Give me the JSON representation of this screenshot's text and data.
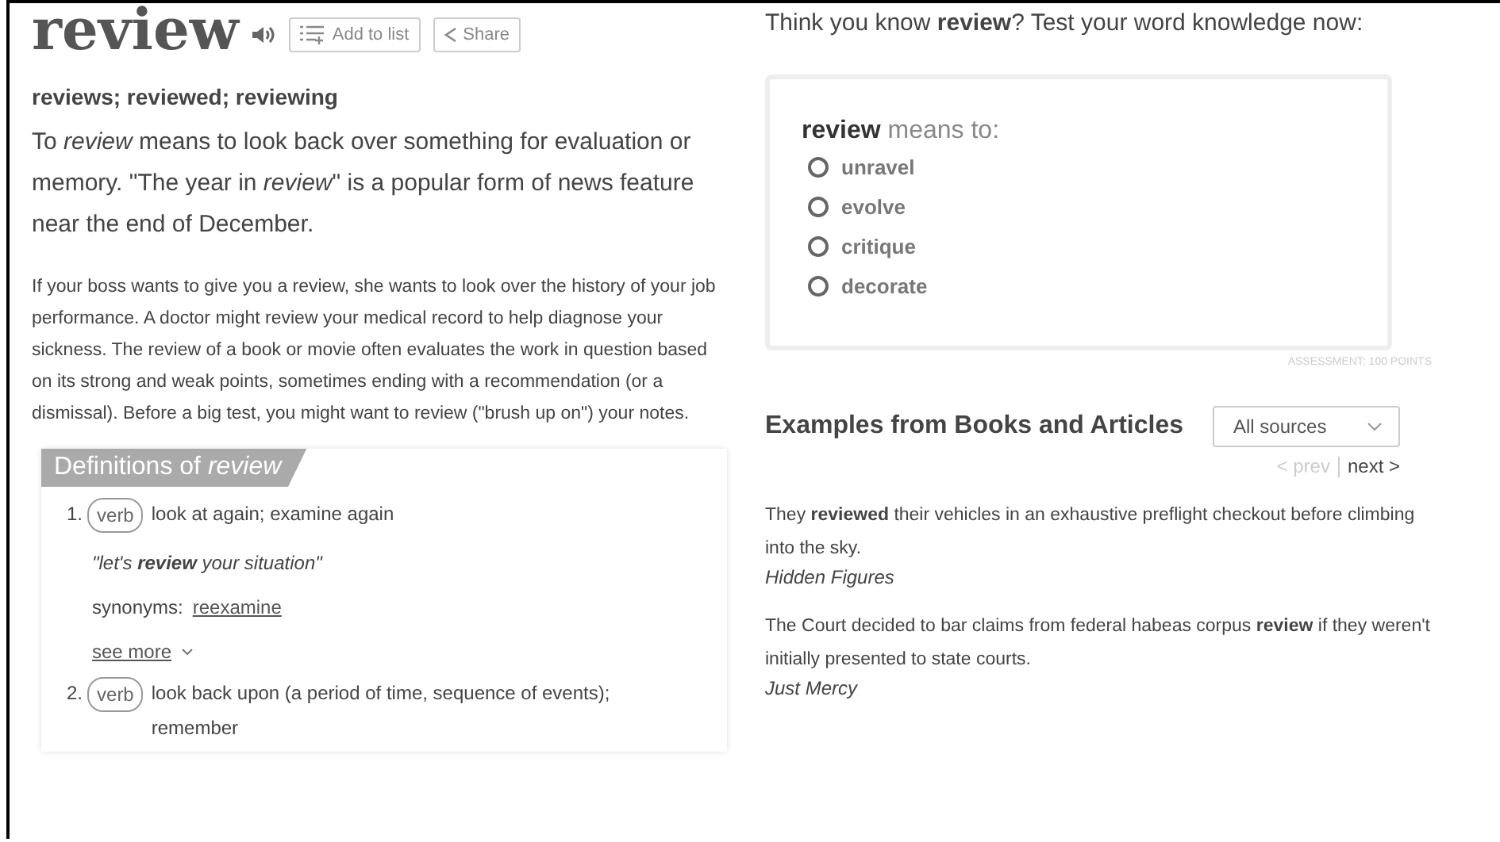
{
  "entry": {
    "word": "review",
    "actions": [
      {
        "label": "Add to list",
        "kind": "list"
      },
      {
        "label": "Share",
        "kind": "share"
      }
    ],
    "forms": "reviews; reviewed; reviewing",
    "short_definition": "To *review* means to look back over something for evaluation or memory. \"The year in *review*\" is a popular form of news feature near the end of December.",
    "long_definition": "If your boss wants to give you a review, she wants to look over the history of your job performance. A doctor might review your medical record to help diagnose your sickness. The review of a book or movie often evaluates the work in question based on its strong and weak points, sometimes ending with a recommendation (or a dismissal). Before a big test, you might want to review (\"brush up on\") your notes."
  },
  "definitions": {
    "title": "Definitions of *review*",
    "senses": [
      {
        "number": "1.",
        "pos": "verb",
        "gloss": "look at again; examine again",
        "example": "\"let's **review** your situation\"",
        "synonyms_label": "synonyms:",
        "synonyms": [
          "reexamine"
        ],
        "see_more": "see more"
      },
      {
        "number": "2.",
        "pos": "verb",
        "gloss": "look back upon (a period of time, sequence of events); remember"
      }
    ]
  },
  "quiz": {
    "prompt": "Think you know **review**? Test your word knowledge now:",
    "question": "**review** means to:",
    "options": [
      {
        "label": "unravel",
        "selected": false
      },
      {
        "label": "evolve",
        "selected": false
      },
      {
        "label": "critique",
        "selected": false
      },
      {
        "label": "decorate",
        "selected": false
      }
    ],
    "footer": "ASSESSMENT: 100 POINTS"
  },
  "examples": {
    "title": "Examples from Books and Articles",
    "filter": "All sources",
    "prev": {
      "label": "< prev",
      "disabled": true
    },
    "next": {
      "label": "next >",
      "disabled": false
    },
    "items": [
      {
        "text": "They **reviewed** their vehicles in an exhaustive preflight checkout before climbing into the sky.",
        "source": "Hidden Figures"
      },
      {
        "text": "The Court decided to bar claims from federal habeas corpus **review** if they weren't initially presented to state courts.",
        "source": "Just Mercy"
      }
    ]
  }
}
